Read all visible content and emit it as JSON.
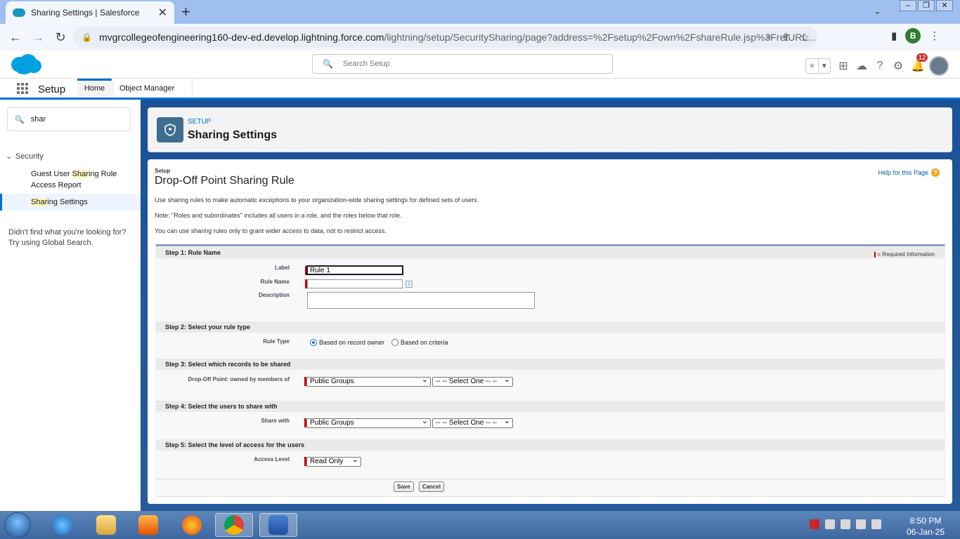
{
  "browser": {
    "tab_title": "Sharing Settings | Salesforce",
    "url_host": "mvgrcollegeofengineering160-dev-ed.develop.lightning.force.com",
    "url_path": "/lightning/setup/SecuritySharing/page?address=%2Fsetup%2Fown%2FshareRule.jsp%3FretURL...",
    "profile_initial": "B"
  },
  "sf": {
    "search_placeholder": "Search Setup",
    "notification_count": "12",
    "app_name": "Setup",
    "nav_home": "Home",
    "nav_object_manager": "Object Manager"
  },
  "sidebar": {
    "quickfind_value": "shar",
    "section": "Security",
    "item1_pre": "Guest User ",
    "item1_hl": "Shar",
    "item1_post": "ing Rule Access Report",
    "item2_hl": "Shar",
    "item2_post": "ing Settings",
    "not_found": "Didn't find what you're looking for? Try using Global Search."
  },
  "header": {
    "crumb": "SETUP",
    "title": "Sharing Settings"
  },
  "content": {
    "setup_label": "Setup",
    "title": "Drop-Off Point Sharing Rule",
    "help": "Help for this Page",
    "line1": "Use sharing rules to make automatic exceptions to your organization-wide sharing settings for defined sets of users.",
    "line2": "Note: \"Roles and subordinates\" includes all users in a role, and the roles below that role.",
    "line3": "You can use sharing rules only to grant wider access to data, not to restrict access."
  },
  "form": {
    "required_info": "= Required Information",
    "step1": "Step 1: Rule Name",
    "label_lbl": "Label",
    "label_val": "Rule 1",
    "rulename_lbl": "Rule Name",
    "rulename_val": "",
    "description_lbl": "Description",
    "step2": "Step 2: Select your rule type",
    "ruletype_lbl": "Rule Type",
    "ruletype_opt1": "Based on record owner",
    "ruletype_opt2": "Based on criteria",
    "step3": "Step 3: Select which records to be shared",
    "owned_lbl": "Drop-Off Point: owned by members of",
    "owned_sel": "Public Groups",
    "owned_sel2": "-- -- Select One -- --",
    "step4": "Step 4: Select the users to share with",
    "share_lbl": "Share with",
    "share_sel": "Public Groups",
    "share_sel2": "-- -- Select One -- --",
    "step5": "Step 5: Select the level of access for the users",
    "access_lbl": "Access Level",
    "access_sel": "Read Only",
    "save": "Save",
    "cancel": "Cancel"
  },
  "taskbar": {
    "time": "8:50 PM",
    "date": "06-Jan-25"
  },
  "colors": {
    "brand": "#0070d2",
    "required": "#cc0000"
  }
}
